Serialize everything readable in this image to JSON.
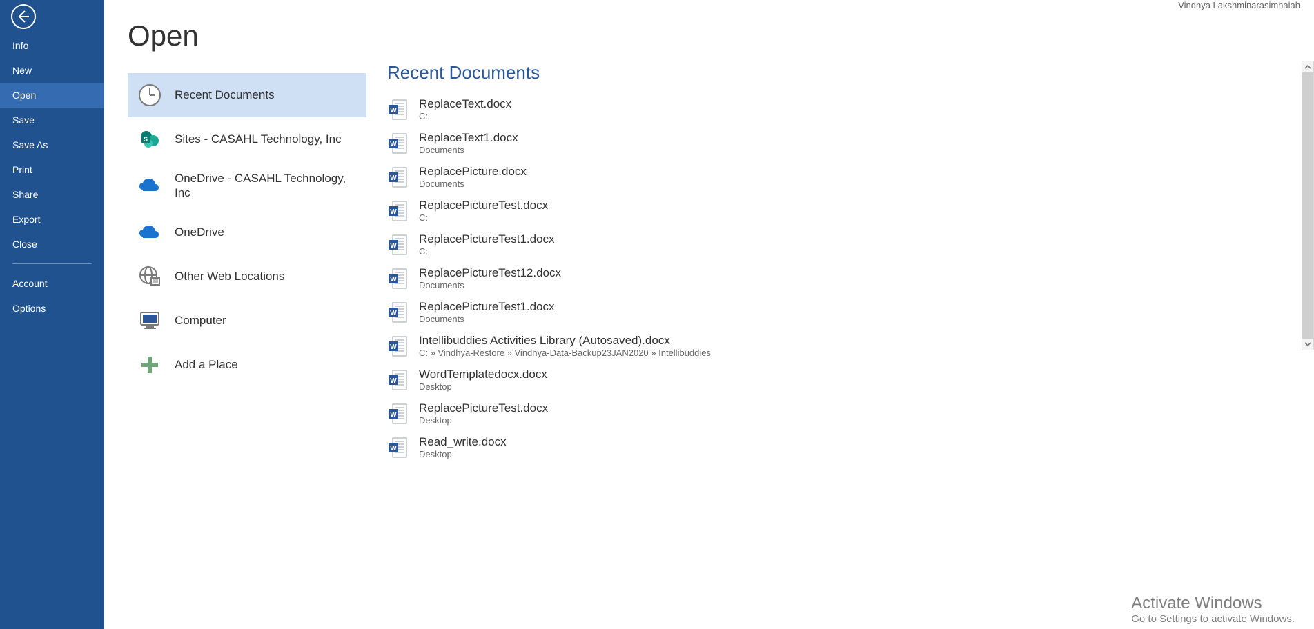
{
  "header": {
    "username": "Vindhya Lakshminarasimhaiah"
  },
  "sidebar": {
    "items": [
      {
        "label": "Info"
      },
      {
        "label": "New"
      },
      {
        "label": "Open",
        "selected": true
      },
      {
        "label": "Save"
      },
      {
        "label": "Save As"
      },
      {
        "label": "Print"
      },
      {
        "label": "Share"
      },
      {
        "label": "Export"
      },
      {
        "label": "Close"
      }
    ],
    "footer": [
      {
        "label": "Account"
      },
      {
        "label": "Options"
      }
    ]
  },
  "page": {
    "title": "Open"
  },
  "places": [
    {
      "icon": "clock-icon",
      "label": "Recent Documents",
      "selected": true
    },
    {
      "icon": "sharepoint-icon",
      "label": "Sites - CASAHL Technology, Inc"
    },
    {
      "icon": "onedrive-icon",
      "label": "OneDrive - CASAHL Technology, Inc"
    },
    {
      "icon": "onedrive-icon",
      "label": "OneDrive"
    },
    {
      "icon": "globe-icon",
      "label": "Other Web Locations"
    },
    {
      "icon": "computer-icon",
      "label": "Computer"
    },
    {
      "icon": "plus-icon",
      "label": "Add a Place"
    }
  ],
  "files": {
    "sectionTitle": "Recent Documents",
    "items": [
      {
        "name": "ReplaceText.docx",
        "path": "C:"
      },
      {
        "name": "ReplaceText1.docx",
        "path": "Documents"
      },
      {
        "name": "ReplacePicture.docx",
        "path": "Documents"
      },
      {
        "name": "ReplacePictureTest.docx",
        "path": "C:"
      },
      {
        "name": "ReplacePictureTest1.docx",
        "path": "C:"
      },
      {
        "name": "ReplacePictureTest12.docx",
        "path": "Documents"
      },
      {
        "name": "ReplacePictureTest1.docx",
        "path": "Documents"
      },
      {
        "name": "Intellibuddies Activities Library (Autosaved).docx",
        "path": "C: » Vindhya-Restore » Vindhya-Data-Backup23JAN2020 » Intellibuddies"
      },
      {
        "name": "WordTemplatedocx.docx",
        "path": "Desktop"
      },
      {
        "name": "ReplacePictureTest.docx",
        "path": "Desktop"
      },
      {
        "name": "Read_write.docx",
        "path": "Desktop"
      }
    ]
  },
  "watermark": {
    "line1": "Activate Windows",
    "line2": "Go to Settings to activate Windows."
  },
  "colors": {
    "accent": "#2b579a",
    "sidebarBg": "#1f528f",
    "selectedPlaceBg": "#cfe0f4"
  }
}
